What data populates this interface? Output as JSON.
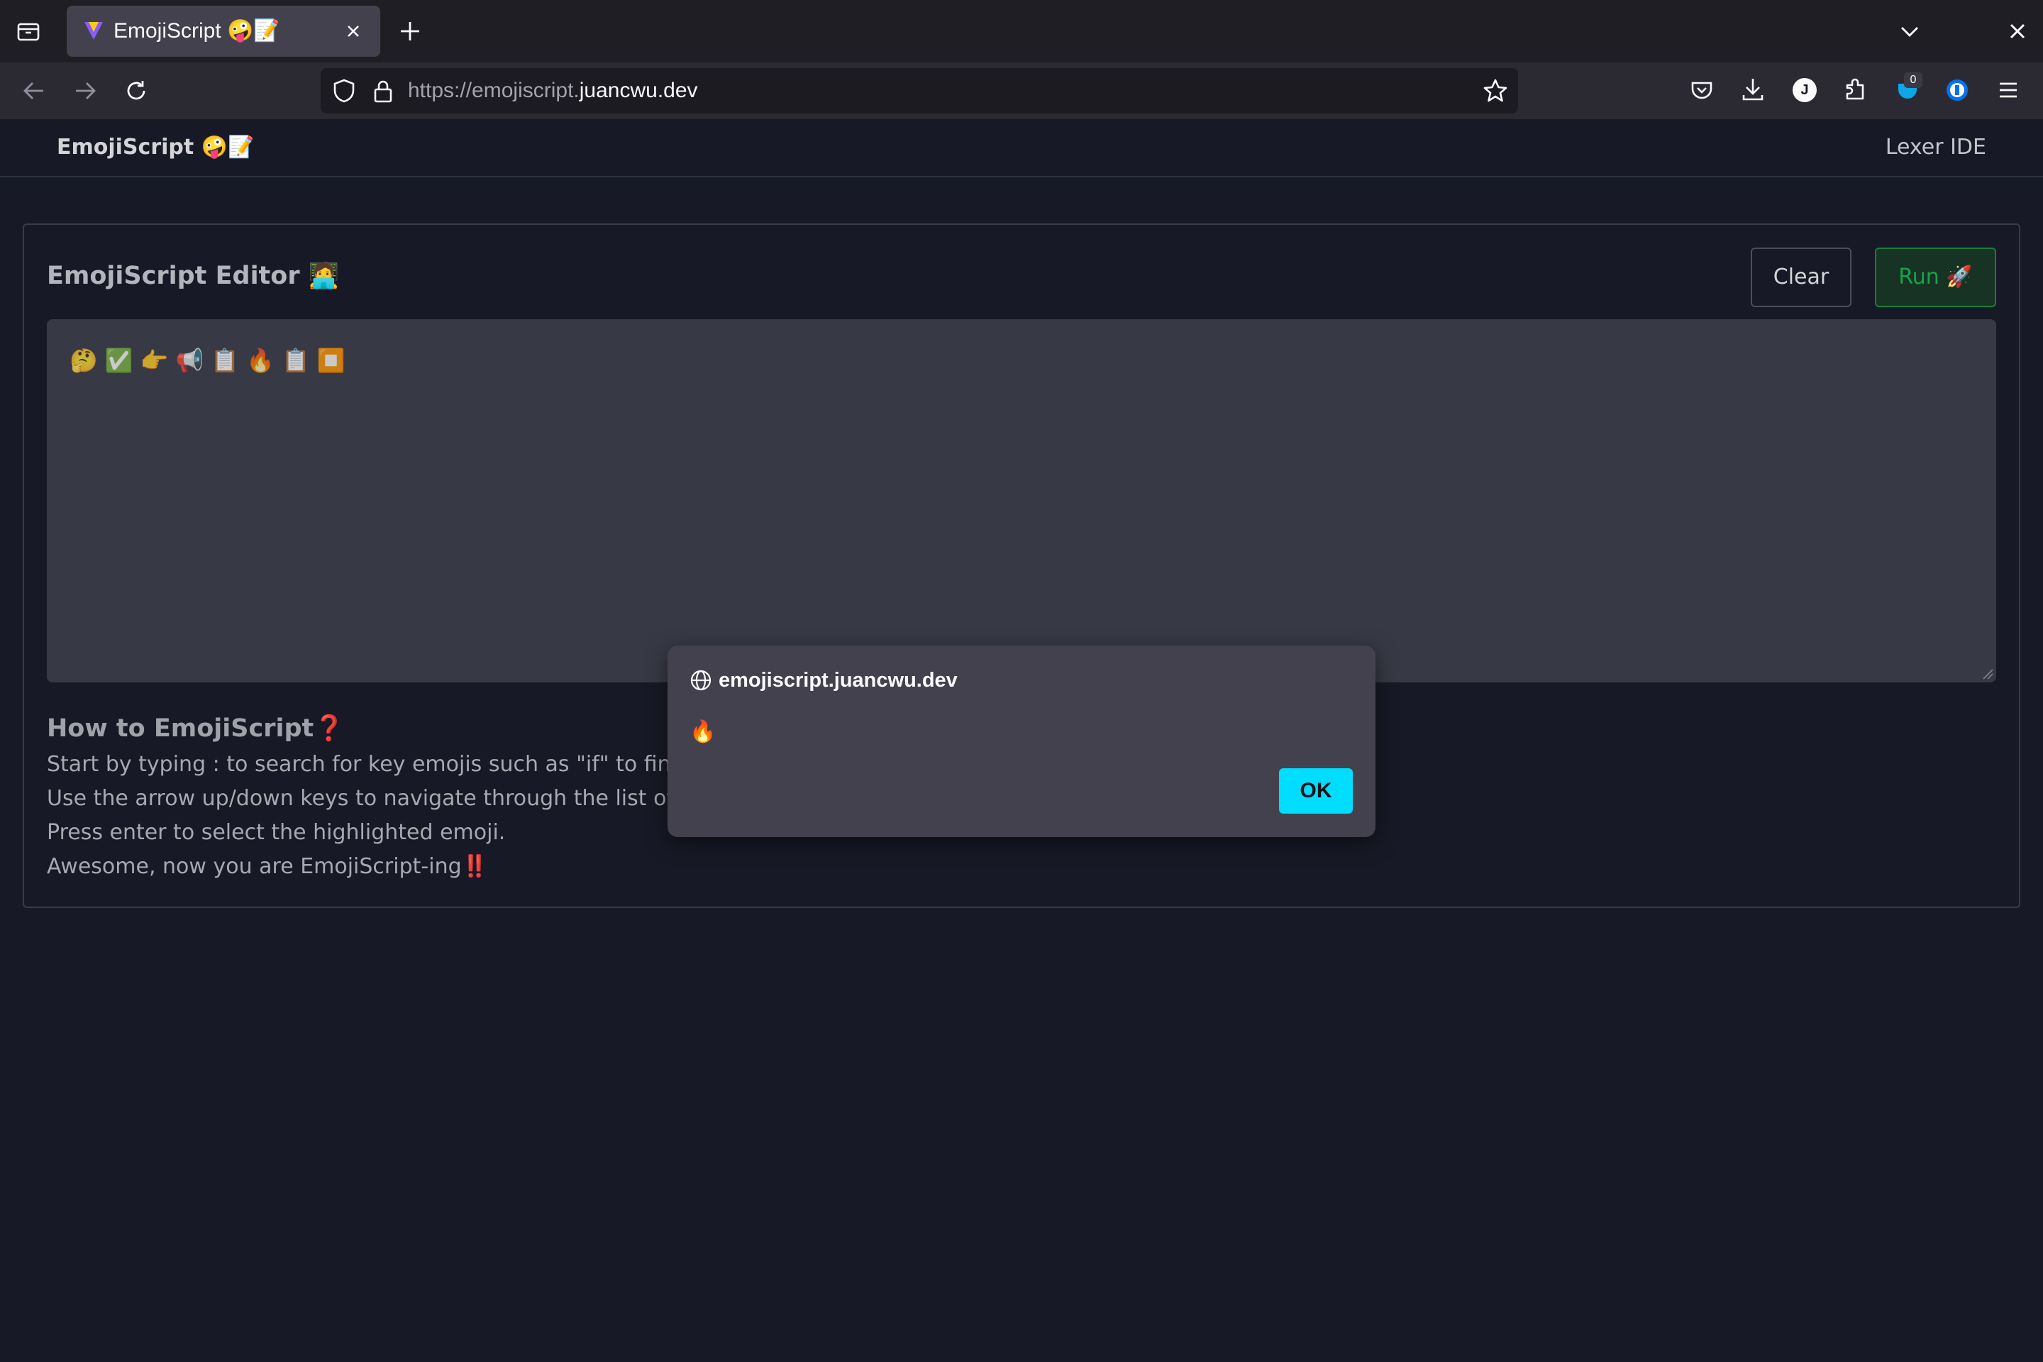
{
  "browser": {
    "tab": {
      "title": "EmojiScript 🤪📝"
    },
    "url": {
      "scheme": "https://",
      "subdomain": "emojiscript.",
      "domain": "juancwu.dev"
    },
    "extension_badge": "0",
    "profile_initial": "J"
  },
  "site": {
    "brand": "EmojiScript 🤪📝",
    "nav_link": "Lexer IDE"
  },
  "editor": {
    "title": "EmojiScript Editor 🧑‍💻",
    "clear_label": "Clear",
    "run_label": "Run 🚀",
    "code": "🤔✅👉📢📋🔥📋⏹️"
  },
  "how_to": {
    "title": "How to EmojiScript❓",
    "lines": [
      "Start by typing : to search for key emojis such as \"if\" to find 🤔",
      "Use the arrow up/down keys to navigate through the list of em",
      "Press enter to select the highlighted emoji.",
      "Awesome, now you are EmojiScript-ing‼️"
    ]
  },
  "dialog": {
    "origin": "emojiscript.juancwu.dev",
    "message": "🔥",
    "ok_label": "OK"
  },
  "colors": {
    "page_background": "#171a26",
    "editor_background": "#373945",
    "run_green": "#16a34a",
    "dialog_ok": "#00ddff"
  }
}
